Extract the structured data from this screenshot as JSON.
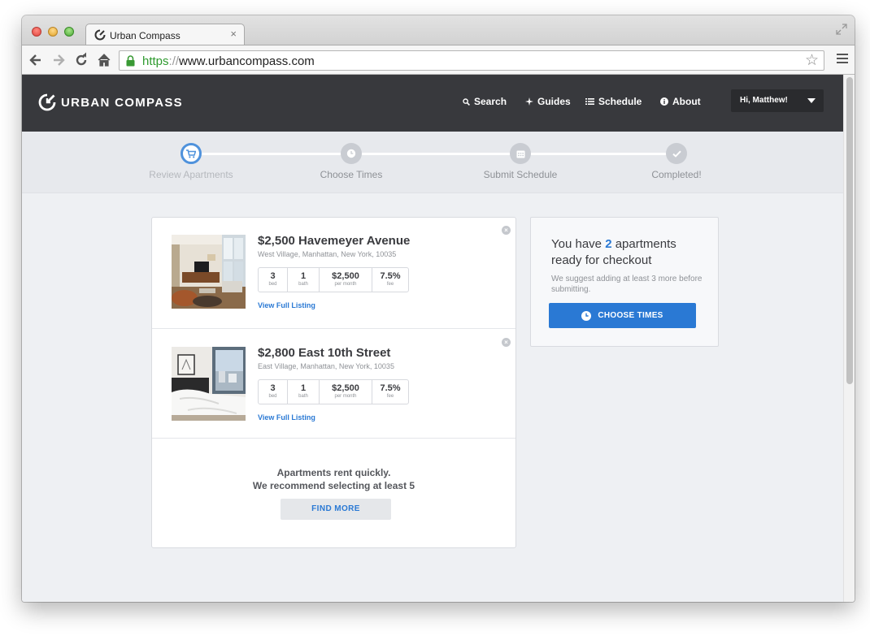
{
  "browser": {
    "tab_title": "Urban Compass",
    "tab_close": "×",
    "url_scheme": "https",
    "url_separator": "://",
    "url_rest": "www.urbancompass.com"
  },
  "site": {
    "logo_text": "URBAN COMPASS",
    "nav": {
      "search": "Search",
      "guides": "Guides",
      "schedule": "Schedule",
      "about": "About"
    },
    "user_greeting": "Hi, Matthew!"
  },
  "steps": [
    {
      "label": "Review Apartments",
      "state": "active"
    },
    {
      "label": "Choose Times",
      "state": "pending"
    },
    {
      "label": "Submit Schedule",
      "state": "pending"
    },
    {
      "label": "Completed!",
      "state": "pending"
    }
  ],
  "listings": [
    {
      "title": "$2,500 Havemeyer Avenue",
      "address": "West Village, Manhattan, New York, 10035",
      "bed": "3",
      "bed_unit": "bed",
      "bath": "1",
      "bath_unit": "bath",
      "rent": "$2,500",
      "rent_unit": "per month",
      "fee": "7.5%",
      "fee_unit": "fee",
      "link": "View Full Listing"
    },
    {
      "title": "$2,800 East 10th Street",
      "address": "East Village, Manhattan, New York, 10035",
      "bed": "3",
      "bed_unit": "bed",
      "bath": "1",
      "bath_unit": "bath",
      "rent": "$2,500",
      "rent_unit": "per month",
      "fee": "7.5%",
      "fee_unit": "fee",
      "link": "View Full Listing"
    }
  ],
  "recommend": {
    "line1": "Apartments rent quickly.",
    "line2": "We recommend selecting at least 5",
    "button": "FIND MORE"
  },
  "checkout": {
    "prefix": "You have",
    "count": "2",
    "suffix": "apartments ready for checkout",
    "note": "We suggest adding at least 3 more before submitting.",
    "button": "CHOOSE TIMES"
  },
  "colors": {
    "accent": "#2a79d4",
    "header_bg": "#38393d",
    "active_step": "#4f92dc"
  }
}
